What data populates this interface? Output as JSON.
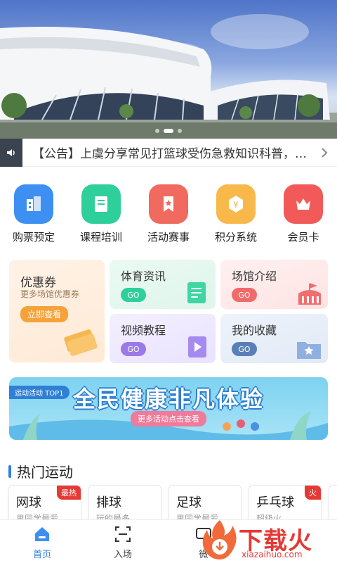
{
  "notice": {
    "text": "【公告】上虞分享常见打篮球受伤急救知识科普，你知道..."
  },
  "quick_nav": [
    {
      "label": "购票预定",
      "icon": "building-icon",
      "color": "#3d8ff2"
    },
    {
      "label": "课程培训",
      "icon": "book-icon",
      "color": "#2fcf9c"
    },
    {
      "label": "活动赛事",
      "icon": "ribbon-icon",
      "color": "#f06a5f"
    },
    {
      "label": "积分系统",
      "icon": "points-icon",
      "color": "#f8b84a"
    },
    {
      "label": "会员卡",
      "icon": "crown-icon",
      "color": "#f25a5a"
    }
  ],
  "cards": {
    "coupon": {
      "title": "优惠券",
      "subtitle": "更多场馆优惠券",
      "button": "立即查看"
    },
    "sports_news": {
      "title": "体育资讯",
      "go": "GO"
    },
    "venue_intro": {
      "title": "场馆介绍",
      "go": "GO"
    },
    "video_tutorial": {
      "title": "视频教程",
      "go": "GO"
    },
    "my_favorites": {
      "title": "我的收藏",
      "go": "GO"
    }
  },
  "promo": {
    "tag": "运动活动 TOP1",
    "headline": "全民健康非凡体验",
    "button": "更多活动点击查看"
  },
  "hot_sports": {
    "title": "热门运动",
    "items": [
      {
        "name": "网球",
        "desc": "男同学最爱",
        "badge": "最热"
      },
      {
        "name": "排球",
        "desc": "玩的最多",
        "badge": ""
      },
      {
        "name": "足球",
        "desc": "男同学最爱",
        "badge": ""
      },
      {
        "name": "乒乓球",
        "desc": "超级火",
        "badge": "火"
      }
    ]
  },
  "tabbar": [
    {
      "label": "首页",
      "icon": "home-icon",
      "active": true
    },
    {
      "label": "入场",
      "icon": "scan-icon",
      "active": false
    },
    {
      "label": "微",
      "icon": "message-icon",
      "active": false
    }
  ],
  "watermark": {
    "text": "下载火",
    "url": "xiazaihuo.com"
  }
}
